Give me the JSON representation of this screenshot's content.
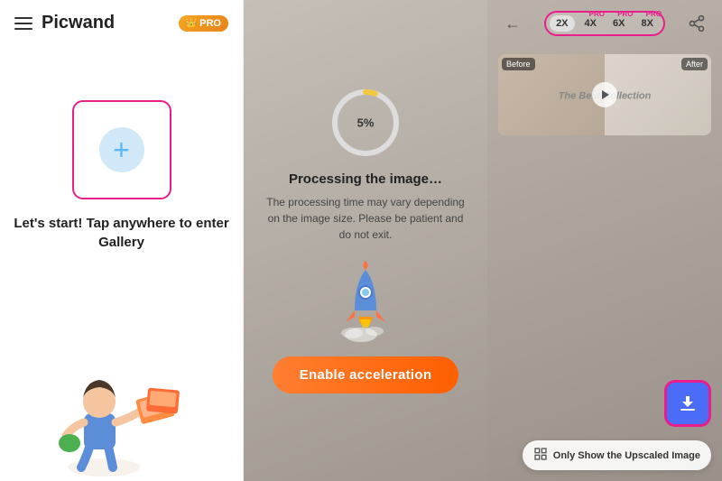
{
  "app": {
    "title": "Picwand",
    "pro_badge": "PRO"
  },
  "left_panel": {
    "gallery_prompt": "Let's start! Tap anywhere to enter Gallery",
    "add_icon": "+"
  },
  "middle_panel": {
    "back_label": "←",
    "progress_percent": "5%",
    "processing_title": "Processing the image…",
    "processing_desc": "The processing time may vary depending on the image size. Please be patient and do not exit.",
    "enable_btn_label": "Enable acceleration"
  },
  "right_panel": {
    "scale_options": [
      {
        "label": "2X",
        "pro": false,
        "active": true
      },
      {
        "label": "4X",
        "pro": true,
        "active": false
      },
      {
        "label": "6X",
        "pro": true,
        "active": false
      },
      {
        "label": "8X",
        "pro": true,
        "active": false
      }
    ],
    "before_label": "Before",
    "after_label": "After",
    "preview_text": "The Best Collection",
    "download_icon": "⬇",
    "upscale_toggle_label": "Only Show the Upscaled Image",
    "nav_arrow": "←"
  }
}
